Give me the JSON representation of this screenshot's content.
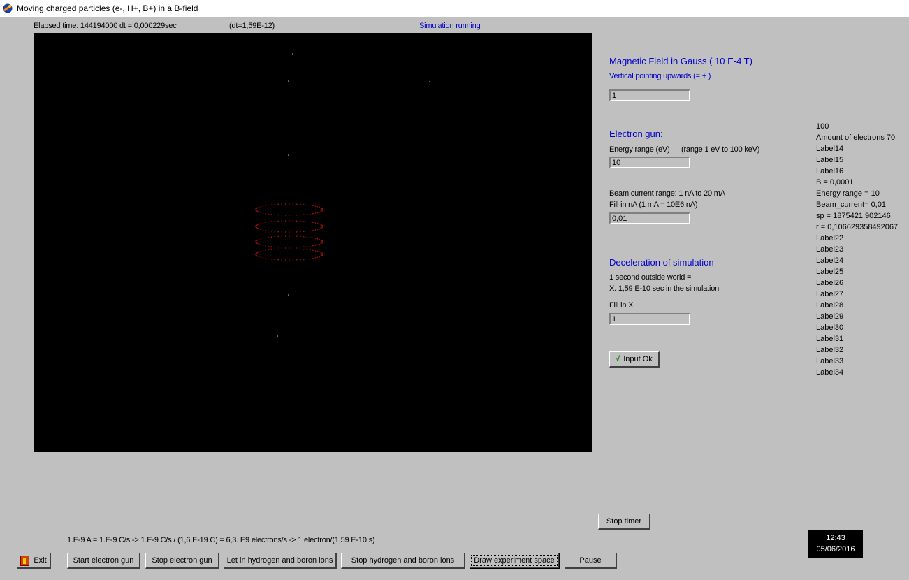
{
  "window": {
    "title": "Moving charged particles (e-, H+, B+) in a B-field"
  },
  "status": {
    "elapsed": "Elapsed time: 144194000 dt   = 0,000229sec",
    "dt": "(dt=1,59E-12)",
    "running": "Simulation running"
  },
  "magnetic": {
    "header": "Magnetic Field in Gauss ( 10 E-4 T)",
    "note": "Vertical pointing upwards (=  + )",
    "value": "1"
  },
  "gun": {
    "header": "Electron gun:",
    "energy_label": "Energy range (eV)",
    "energy_range": "(range 1 eV to 100 keV)",
    "energy_value": "10",
    "beam_label": "Beam current range: 1 nA to 20 mA",
    "fill_label": "Fill in nA (1 mA = 10E6 nA)",
    "beam_value": "0,01"
  },
  "decel": {
    "header": "Deceleration of simulation",
    "line1": "1 second outside world  =",
    "line2": "X. 1,59 E-10 sec in the simulation",
    "fill_label": "Fill in X",
    "value": "1"
  },
  "input_ok": {
    "mark": "√",
    "label": "Input Ok"
  },
  "right_labels": [
    "100",
    "Amount of electrons 70",
    "Label14",
    "Label15",
    "Label16",
    "B = 0,0001",
    "Energy range = 10",
    "Beam_current= 0,01",
    "sp =  1875421,902146",
    "r =  0,106629358492067",
    "Label22",
    "Label23",
    "Label24",
    "Label25",
    "Label26",
    "Label27",
    "Label28",
    "Label29",
    "Label30",
    "Label31",
    "Label32",
    "Label33",
    "Label34"
  ],
  "formula": "1.E-9 A = 1.E-9 C/s  ->  1.E-9 C/s / (1,6.E-19 C) = 6,3. E9   electrons/s  -> 1 electron/(1,59 E-10 s)",
  "buttons": {
    "stop_timer": "Stop timer",
    "exit": "Exit",
    "start_gun": "Start electron gun",
    "stop_gun": "Stop electron gun",
    "let_in_ions": "Let in hydrogen and boron ions",
    "stop_ions": "Stop hydrogen and boron ions",
    "draw_space": "Draw experiment space",
    "pause": "Pause"
  },
  "clock": {
    "time": "12:43",
    "date": "05/06/2016"
  },
  "colors": {
    "particle": "#b01010",
    "panel": "#c0c0c0",
    "label_blue": "#0000cc"
  }
}
